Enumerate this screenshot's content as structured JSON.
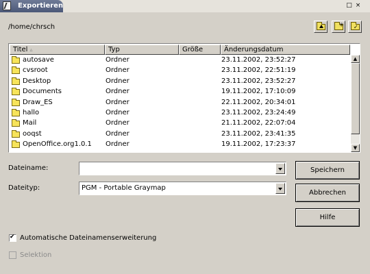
{
  "window": {
    "title": "Exportieren",
    "maximize_glyph": "□",
    "close_glyph": "×"
  },
  "path": "/home/chrsch",
  "toolbar": {
    "icons": [
      "folder-up-icon",
      "new-folder-icon",
      "default-folder-icon"
    ]
  },
  "filelist": {
    "columns": [
      "Titel",
      "Typ",
      "Größe",
      "Änderungsdatum"
    ],
    "sorted_by": "Titel",
    "sort_indicator": "▵",
    "rows": [
      {
        "name": "autosave",
        "type": "Ordner",
        "size": "",
        "modified": "23.11.2002, 23:52:27"
      },
      {
        "name": "cvsroot",
        "type": "Ordner",
        "size": "",
        "modified": "23.11.2002, 22:51:19"
      },
      {
        "name": "Desktop",
        "type": "Ordner",
        "size": "",
        "modified": "23.11.2002, 23:52:27"
      },
      {
        "name": "Documents",
        "type": "Ordner",
        "size": "",
        "modified": "19.11.2002, 17:10:09"
      },
      {
        "name": "Draw_ES",
        "type": "Ordner",
        "size": "",
        "modified": "22.11.2002, 20:34:01"
      },
      {
        "name": "hallo",
        "type": "Ordner",
        "size": "",
        "modified": "23.11.2002, 23:24:49"
      },
      {
        "name": "Mail",
        "type": "Ordner",
        "size": "",
        "modified": "21.11.2002, 22:07:04"
      },
      {
        "name": "ooqst",
        "type": "Ordner",
        "size": "",
        "modified": "23.11.2002, 23:41:35"
      },
      {
        "name": "OpenOffice.org1.0.1",
        "type": "Ordner",
        "size": "",
        "modified": "19.11.2002, 17:23:37"
      }
    ]
  },
  "form": {
    "filename_label": "Dateiname:",
    "filename_value": "",
    "filetype_label": "Dateityp:",
    "filetype_value": "PGM - Portable Graymap"
  },
  "buttons": {
    "save": "Speichern",
    "cancel": "Abbrechen",
    "help": "Hilfe"
  },
  "options": {
    "auto_extension_label": "Automatische Dateinamenserweiterung",
    "auto_extension_checked": true,
    "selection_label": "Selektion",
    "selection_checked": false,
    "selection_enabled": false
  },
  "colors": {
    "dialog_bg": "#d4d0c8",
    "titlebar_active": "#4b5878",
    "folder": "#f7e45a"
  }
}
